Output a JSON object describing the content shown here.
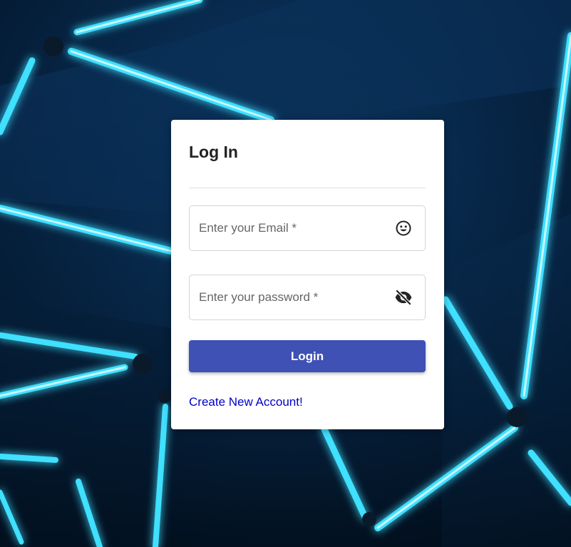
{
  "login_card": {
    "title": "Log In",
    "email_placeholder": "Enter your Email *",
    "password_placeholder": "Enter your password *",
    "email_icon": "smiley-face-icon",
    "password_icon": "eye-off-icon",
    "login_label": "Login",
    "create_account_label": "Create New Account!"
  },
  "colors": {
    "primary_button": "#3f51b5",
    "link": "#0000cc",
    "neon": "#3fe0ff",
    "background": "#082a4d"
  }
}
